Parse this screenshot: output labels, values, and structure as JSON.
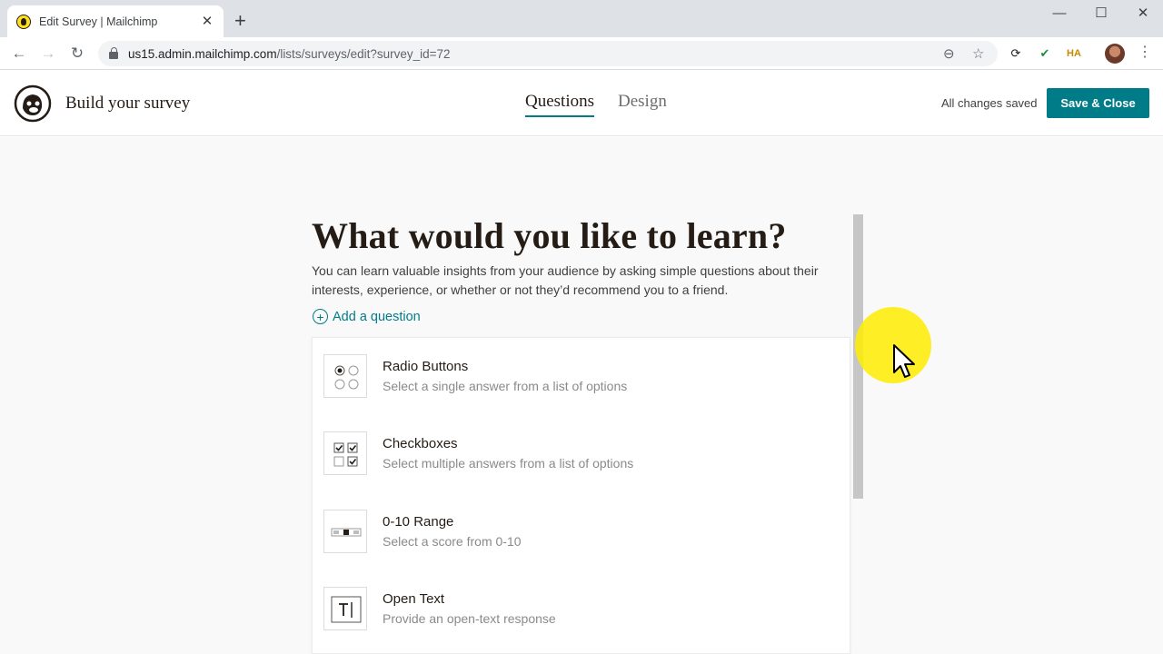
{
  "browser": {
    "tab_title": "Edit Survey | Mailchimp",
    "url_domain": "us15.admin.mailchimp.com",
    "url_path": "/lists/surveys/edit?survey_id=72"
  },
  "header": {
    "title": "Build your survey",
    "tabs": [
      "Questions",
      "Design"
    ],
    "status": "All changes saved",
    "save_label": "Save & Close"
  },
  "main": {
    "heading": "What would you like to learn?",
    "intro": "You can learn valuable insights from your audience by asking simple questions about their interests, experience, or whether or not they’d recommend you to a friend.",
    "add_question": "Add a question",
    "questions": [
      {
        "label": "Radio Buttons",
        "description": "Select a single answer from a list of options",
        "icon": "radio-buttons-icon"
      },
      {
        "label": "Checkboxes",
        "description": "Select multiple answers from a list of options",
        "icon": "checkboxes-icon"
      },
      {
        "label": "0-10 Range",
        "description": "Select a score from 0-10",
        "icon": "range-icon"
      },
      {
        "label": "Open Text",
        "description": "Provide an open-text response",
        "icon": "open-text-icon"
      }
    ]
  },
  "colors": {
    "accent": "#007c89",
    "cursor_highlight": "#ffec00"
  }
}
